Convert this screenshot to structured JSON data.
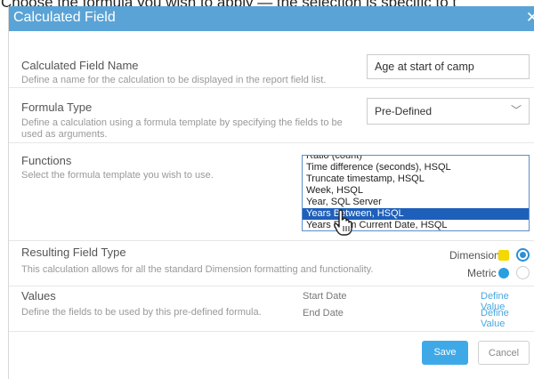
{
  "caption": "Choose the formula you wish to apply — the selection is specific to t",
  "dialog": {
    "title": "Calculated Field",
    "close_icon": "close-icon",
    "name_section": {
      "label": "Calculated Field Name",
      "description": "Define a name for the calculation to be displayed in the report field list.",
      "value": "Age at start of camp"
    },
    "formula_section": {
      "label": "Formula Type",
      "description": "Define a calculation using a formula template by specifying the fields to be used as arguments.",
      "selected": "Pre-Defined",
      "chevron_icon": "chevron-down-icon"
    },
    "functions_section": {
      "label": "Functions",
      "description": "Select the formula template you wish to use.",
      "items": [
        "Ratio (count)",
        "Time difference (seconds), HSQL",
        "Truncate timestamp, HSQL",
        "Week, HSQL",
        "Year, SQL Server",
        "Years Between, HSQL",
        "Years From Current Date, HSQL"
      ],
      "selected_index": 5
    },
    "result_section": {
      "label": "Resulting Field Type",
      "description": "This calculation allows for all the standard Dimension formatting and functionality.",
      "dimension_label": "Dimension",
      "metric_label": "Metric",
      "dimension_color": "#f5d800",
      "metric_color": "#2a9fe0",
      "selected": "Dimension"
    },
    "values_section": {
      "label": "Values",
      "description": "Define the fields to be used by this pre-defined formula.",
      "rows": [
        {
          "name": "Start Date",
          "action": "Define Value"
        },
        {
          "name": "End Date",
          "action": "Define Value"
        }
      ]
    },
    "footer": {
      "save_label": "Save",
      "cancel_label": "Cancel",
      "save_color": "#3fa9e8"
    }
  }
}
